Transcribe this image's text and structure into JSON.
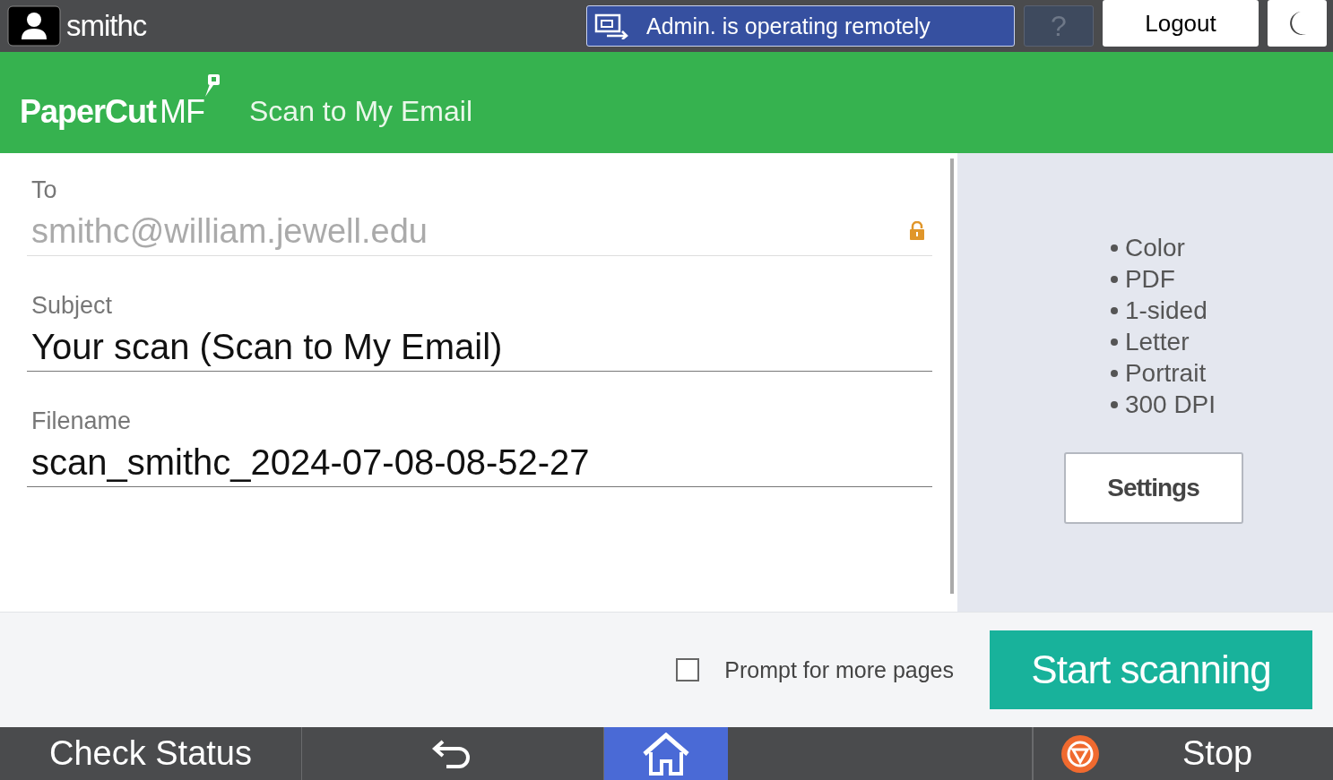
{
  "top_bar": {
    "user": "smithc",
    "remote_banner": "Admin. is operating remotely",
    "help": "?",
    "logout": "Logout"
  },
  "header": {
    "logo": "PaperCut",
    "logo_suffix": "MF",
    "title": "Scan to My Email"
  },
  "fields": [
    {
      "label": "To",
      "value": "smithc@william.jewell.edu",
      "locked": true
    },
    {
      "label": "Subject",
      "value": "Your scan (Scan to My Email)",
      "locked": false
    },
    {
      "label": "Filename",
      "value": "scan_smithc_2024-07-08-08-52-27",
      "locked": false
    }
  ],
  "summary": [
    "Color",
    "PDF",
    "1-sided",
    "Letter",
    "Portrait",
    "300 DPI"
  ],
  "settings_button": "Settings",
  "prompt_more_pages": {
    "label": "Prompt for more pages",
    "checked": false
  },
  "start_button": "Start scanning",
  "footer": {
    "check_status": "Check Status",
    "stop": "Stop",
    "tabs": [
      {
        "kind": "back",
        "selected": false
      },
      {
        "kind": "home",
        "selected": true
      }
    ]
  }
}
